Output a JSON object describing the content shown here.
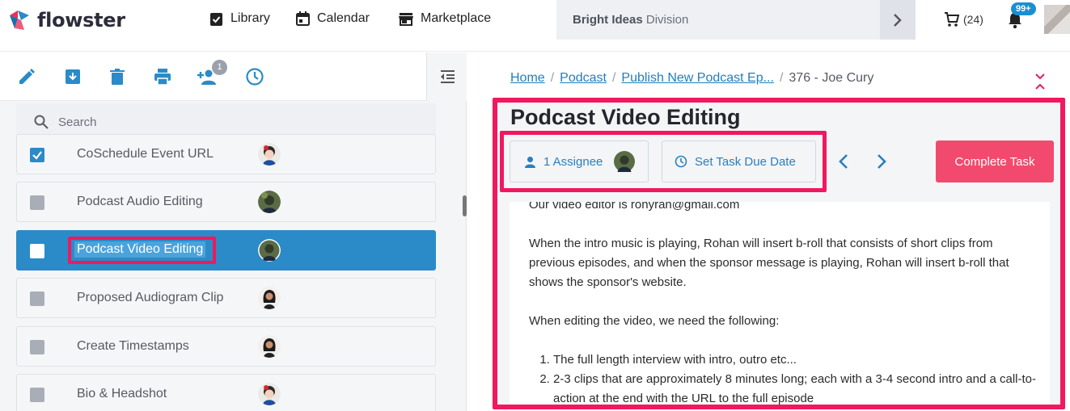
{
  "app": {
    "name": "flowster"
  },
  "nav": {
    "library": "Library",
    "calendar": "Calendar",
    "marketplace": "Marketplace"
  },
  "division": {
    "bold": "Bright Ideas",
    "rest": " Division"
  },
  "cart": {
    "count": "(24)"
  },
  "notifications": {
    "badge": "99+"
  },
  "toolbar": {
    "assign_badge": "1"
  },
  "search": {
    "placeholder": "Search"
  },
  "tasks": [
    {
      "label": "CoSchedule Event URL",
      "checked": true,
      "active": false
    },
    {
      "label": "Podcast Audio Editing",
      "checked": false,
      "active": false
    },
    {
      "label": "Podcast Video Editing",
      "checked": false,
      "active": true
    },
    {
      "label": "Proposed Audiogram Clip",
      "checked": false,
      "active": false
    },
    {
      "label": "Create Timestamps",
      "checked": false,
      "active": false
    },
    {
      "label": "Bio & Headshot",
      "checked": false,
      "active": false
    }
  ],
  "breadcrumb": {
    "home": "Home",
    "podcast": "Podcast",
    "process": "Publish New Podcast Ep...",
    "current": "376 - Joe Cury"
  },
  "task": {
    "title": "Podcast Video Editing",
    "assignee_label": "1 Assignee",
    "due_date_label": "Set Task Due Date",
    "complete_label": "Complete Task"
  },
  "content": {
    "line1": "Our video editor is ronyran@gmail.com",
    "para2": "When the intro music is playing, Rohan will insert b-roll that consists of short clips from previous episodes, and when the sponsor message is playing, Rohan will insert b-roll that shows the sponsor's website.",
    "para3": "When editing the video, we need the following:",
    "list": [
      "The full length interview with intro, outro etc...",
      "2-3 clips that are approximately 8 minutes long; each with a 3-4 second intro and a call-to-action at the end with the URL to the full episode"
    ]
  },
  "colors": {
    "accent": "#2a8bc8",
    "highlight": "#f0185e",
    "complete": "#f24a6e",
    "link": "#1e7fbf"
  }
}
